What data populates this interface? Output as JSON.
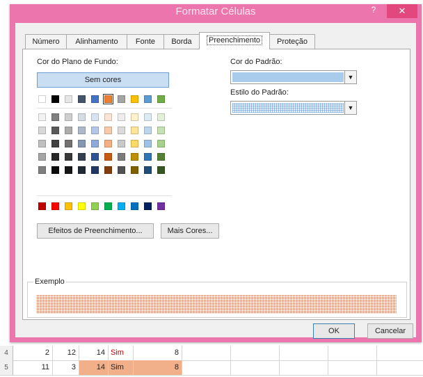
{
  "dialog": {
    "title": "Formatar Células",
    "help_label": "?",
    "close_label": "✕",
    "tabs": [
      {
        "label": "Número",
        "active": false
      },
      {
        "label": "Alinhamento",
        "active": false
      },
      {
        "label": "Fonte",
        "active": false
      },
      {
        "label": "Borda",
        "active": false
      },
      {
        "label": "Preenchimento",
        "active": true
      },
      {
        "label": "Proteção",
        "active": false
      }
    ],
    "fill": {
      "background_color_label": "Cor do Plano de Fundo:",
      "no_color_label": "Sem cores",
      "selected_color": "#ed7d31",
      "theme_top_row": [
        "#ffffff",
        "#000000",
        "#e7e6e6",
        "#44546a",
        "#4472c4",
        "#ed7d31",
        "#a5a5a5",
        "#ffc000",
        "#5b9bd5",
        "#70ad47"
      ],
      "theme_shades": [
        [
          "#f2f2f2",
          "#7f7f7f",
          "#d0cece",
          "#d6dce4",
          "#d9e2f3",
          "#fbe4d5",
          "#ededed",
          "#fff2cc",
          "#deeaf6",
          "#e2efd9"
        ],
        [
          "#d8d8d8",
          "#595959",
          "#aeabab",
          "#adb9ca",
          "#b4c6e7",
          "#f7caac",
          "#dbdbdb",
          "#fee599",
          "#bdd6ee",
          "#c5e0b3"
        ],
        [
          "#bfbfbf",
          "#3f3f3f",
          "#757070",
          "#8496b0",
          "#8eaadb",
          "#f4b083",
          "#c9c9c9",
          "#ffd965",
          "#9cc3e5",
          "#a8d08d"
        ],
        [
          "#a5a5a5",
          "#262626",
          "#3a3838",
          "#323f4f",
          "#2f5496",
          "#c55a11",
          "#7b7b7b",
          "#bf8f00",
          "#2e75b5",
          "#538135"
        ],
        [
          "#7f7f7f",
          "#0c0c0c",
          "#171616",
          "#222a35",
          "#1f3864",
          "#833c0b",
          "#525252",
          "#7f6000",
          "#1e4e79",
          "#375623"
        ]
      ],
      "standard_colors": [
        "#c00000",
        "#ff0000",
        "#ffc000",
        "#ffff00",
        "#92d050",
        "#00b050",
        "#00b0f0",
        "#0070c0",
        "#002060",
        "#7030a0"
      ],
      "fill_effects_label": "Efeitos de Preenchimento...",
      "more_colors_label": "Mais Cores...",
      "pattern_color_label": "Cor do Padrão:",
      "pattern_color_value": "#a9cbec",
      "pattern_style_label": "Estilo do Padrão:",
      "sample_label": "Exemplo"
    },
    "ok_label": "OK",
    "cancel_label": "Cancelar"
  },
  "sheet": {
    "rows": [
      {
        "row": "4",
        "cells": [
          "2",
          "12",
          "14",
          "Sim",
          "8"
        ]
      },
      {
        "row": "5",
        "cells": [
          "11",
          "3",
          "14",
          "Sim",
          "8"
        ]
      }
    ]
  }
}
